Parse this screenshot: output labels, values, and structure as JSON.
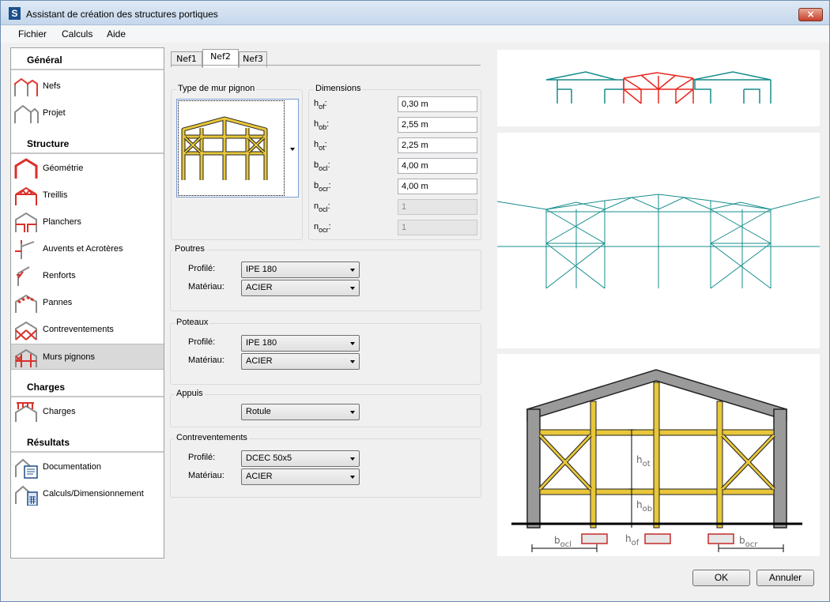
{
  "window": {
    "title": "Assistant de création des structures portiques",
    "app_icon": "S",
    "close_icon": "×"
  },
  "menu": [
    "Fichier",
    "Calculs",
    "Aide"
  ],
  "sidebar": {
    "sections": [
      {
        "title": "Général",
        "items": [
          "Nefs",
          "Projet"
        ]
      },
      {
        "title": "Structure",
        "items": [
          "Géométrie",
          "Treillis",
          "Planchers",
          "Auvents et Acrotères",
          "Renforts",
          "Pannes",
          "Contreventements",
          "Murs pignons"
        ]
      },
      {
        "title": "Charges",
        "items": [
          "Charges"
        ]
      },
      {
        "title": "Résultats",
        "items": [
          "Documentation",
          "Calculs/Dimensionnement"
        ]
      }
    ],
    "selected": "Murs pignons"
  },
  "tabs": {
    "items": [
      "Nef1",
      "Nef2",
      "Nef3"
    ],
    "active": "Nef2"
  },
  "gable": {
    "title": "Type de mur pignon"
  },
  "dimensions": {
    "title": "Dimensions",
    "rows": [
      {
        "main": "h",
        "sub": "of",
        "value": "0,30 m",
        "enabled": true
      },
      {
        "main": "h",
        "sub": "ob",
        "value": "2,55 m",
        "enabled": true
      },
      {
        "main": "h",
        "sub": "ot",
        "value": "2,25 m",
        "enabled": true
      },
      {
        "main": "b",
        "sub": "ocl",
        "value": "4,00 m",
        "enabled": true
      },
      {
        "main": "b",
        "sub": "ocr",
        "value": "4,00 m",
        "enabled": true
      },
      {
        "main": "n",
        "sub": "ocl",
        "value": "1",
        "enabled": false
      },
      {
        "main": "n",
        "sub": "ocr",
        "value": "1",
        "enabled": false
      }
    ]
  },
  "poutres": {
    "title": "Poutres",
    "profile_label": "Profilé:",
    "profile": "IPE 180",
    "material_label": "Matériau:",
    "material": "ACIER"
  },
  "poteaux": {
    "title": "Poteaux",
    "profile_label": "Profilé:",
    "profile": "IPE 180",
    "material_label": "Matériau:",
    "material": "ACIER"
  },
  "appuis": {
    "title": "Appuis",
    "value": "Rotule"
  },
  "contreventements": {
    "title": "Contreventements",
    "profile_label": "Profilé:",
    "profile": "DCEC 50x5",
    "material_label": "Matériau:",
    "material": "ACIER"
  },
  "diagram_labels": {
    "h": "h",
    "b": "b",
    "ot": "ot",
    "ob": "ob",
    "of": "of",
    "ocl": "ocl",
    "ocr": "ocr"
  },
  "buttons": {
    "ok": "OK",
    "cancel": "Annuler"
  },
  "colors": {
    "teal": "#168c8c",
    "red": "#e8261f",
    "yellow": "#e8c73a",
    "selected": "#d9d9d9"
  }
}
